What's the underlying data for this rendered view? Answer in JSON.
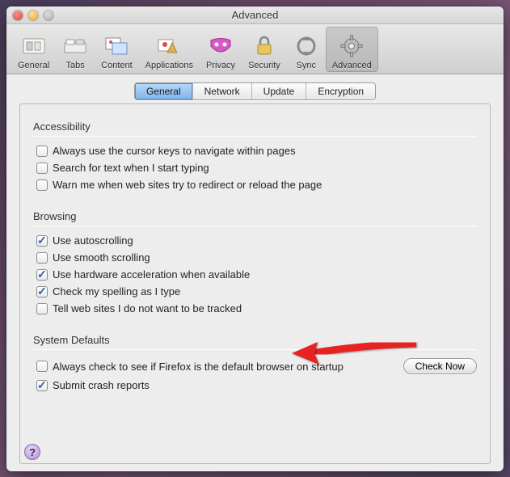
{
  "window": {
    "title": "Advanced"
  },
  "toolbar": {
    "items": [
      {
        "label": "General"
      },
      {
        "label": "Tabs"
      },
      {
        "label": "Content"
      },
      {
        "label": "Applications"
      },
      {
        "label": "Privacy"
      },
      {
        "label": "Security"
      },
      {
        "label": "Sync"
      },
      {
        "label": "Advanced"
      }
    ]
  },
  "tabs": {
    "items": [
      {
        "label": "General"
      },
      {
        "label": "Network"
      },
      {
        "label": "Update"
      },
      {
        "label": "Encryption"
      }
    ],
    "selected": 0
  },
  "sections": {
    "accessibility": {
      "title": "Accessibility",
      "items": [
        {
          "label": "Always use the cursor keys to navigate within pages",
          "checked": false
        },
        {
          "label": "Search for text when I start typing",
          "checked": false
        },
        {
          "label": "Warn me when web sites try to redirect or reload the page",
          "checked": false
        }
      ]
    },
    "browsing": {
      "title": "Browsing",
      "items": [
        {
          "label": "Use autoscrolling",
          "checked": true
        },
        {
          "label": "Use smooth scrolling",
          "checked": false
        },
        {
          "label": "Use hardware acceleration when available",
          "checked": true
        },
        {
          "label": "Check my spelling as I type",
          "checked": true
        },
        {
          "label": "Tell web sites I do not want to be tracked",
          "checked": false
        }
      ]
    },
    "defaults": {
      "title": "System Defaults",
      "check_default": {
        "label": "Always check to see if Firefox is the default browser on startup",
        "checked": false
      },
      "check_now_button": "Check Now",
      "crash": {
        "label": "Submit crash reports",
        "checked": true
      }
    }
  },
  "help_button": "?"
}
